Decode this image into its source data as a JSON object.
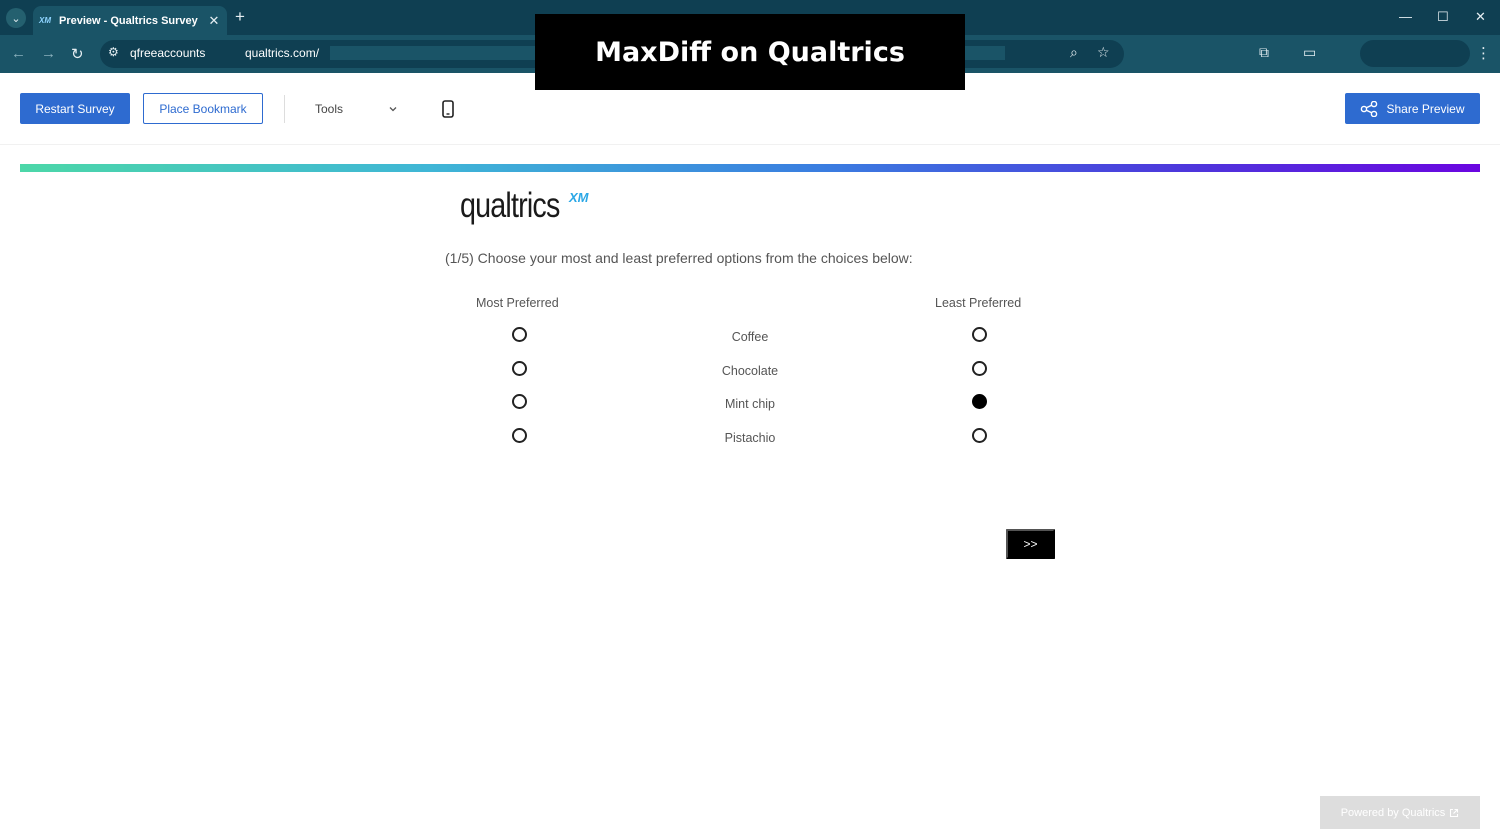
{
  "browser": {
    "tab_favicon": "XM",
    "tab_title": "Preview - Qualtrics Survey | Qu",
    "tab_close": "✕",
    "new_tab": "+",
    "tab_menu": "⌄",
    "url_part_1": "qfreeaccounts",
    "url_part_2": "qualtrics.com/",
    "window_controls": [
      "—",
      "☐",
      "✕"
    ],
    "overlay_title": "MaxDiff on Qualtrics"
  },
  "toolbar": {
    "restart_label": "Restart Survey",
    "bookmark_label": "Place Bookmark",
    "tools_label": "Tools",
    "share_label": "Share Preview"
  },
  "survey": {
    "progress": 1.0,
    "logo_text": "qualtrics",
    "logo_suffix": "XM",
    "question": "(1/5) Choose your most and least preferred options from the choices below:",
    "most_header": "Most Preferred",
    "least_header": "Least Preferred",
    "choices": [
      {
        "label": "Coffee",
        "most_selected": false,
        "least_selected": false
      },
      {
        "label": "Chocolate",
        "most_selected": false,
        "least_selected": false
      },
      {
        "label": "Mint chip",
        "most_selected": false,
        "least_selected": true
      },
      {
        "label": "Pistachio",
        "most_selected": false,
        "least_selected": false
      }
    ],
    "next_label": ">>"
  },
  "footer": {
    "powered_label": "Powered by Qualtrics"
  },
  "colors": {
    "chrome_dark": "#0f3f52",
    "chrome_mid": "#1a5467",
    "primary_blue": "#2e6bd0",
    "progress_start": "#4cd7a8",
    "progress_end": "#6a06e0"
  }
}
